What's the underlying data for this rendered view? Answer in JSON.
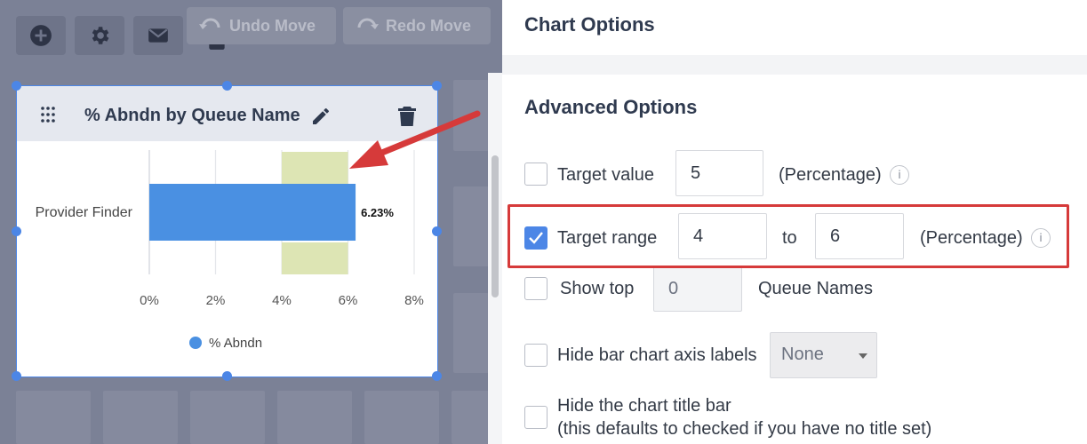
{
  "toolbar": {
    "undo_label": "Undo Move",
    "redo_label": "Redo Move"
  },
  "widget": {
    "title": "% Abndn by Queue Name"
  },
  "chart_data": {
    "type": "bar",
    "orientation": "horizontal",
    "categories": [
      "Provider Finder"
    ],
    "series": [
      {
        "name": "% Abndn",
        "values": [
          6.23
        ],
        "color": "#4a90e2"
      }
    ],
    "data_labels": [
      "6.23%"
    ],
    "x_ticks": [
      "0%",
      "2%",
      "4%",
      "6%",
      "8%"
    ],
    "xlim": [
      0,
      8
    ],
    "target_range": [
      4,
      6
    ],
    "target_color": "#dde5b4",
    "grid": true,
    "legend_position": "bottom"
  },
  "panel": {
    "title": "Chart Options",
    "section_title": "Advanced Options",
    "target_value": {
      "label": "Target value",
      "value": "5",
      "unit": "(Percentage)",
      "checked": false
    },
    "target_range": {
      "label": "Target range",
      "from": "4",
      "to_label": "to",
      "to": "6",
      "unit": "(Percentage)",
      "checked": true
    },
    "show_top": {
      "label": "Show top",
      "value": "0",
      "suffix": "Queue Names",
      "checked": false
    },
    "hide_axis_labels": {
      "label": "Hide bar chart axis labels",
      "selected": "None",
      "checked": false
    },
    "hide_title_bar": {
      "label": "Hide the chart title bar",
      "note": "(this defaults to checked if you have no title set)",
      "checked": false
    },
    "info_glyph": "i"
  },
  "colors": {
    "accent": "#4c86e6",
    "highlight": "#d63a3a",
    "bar": "#4a90e2"
  }
}
